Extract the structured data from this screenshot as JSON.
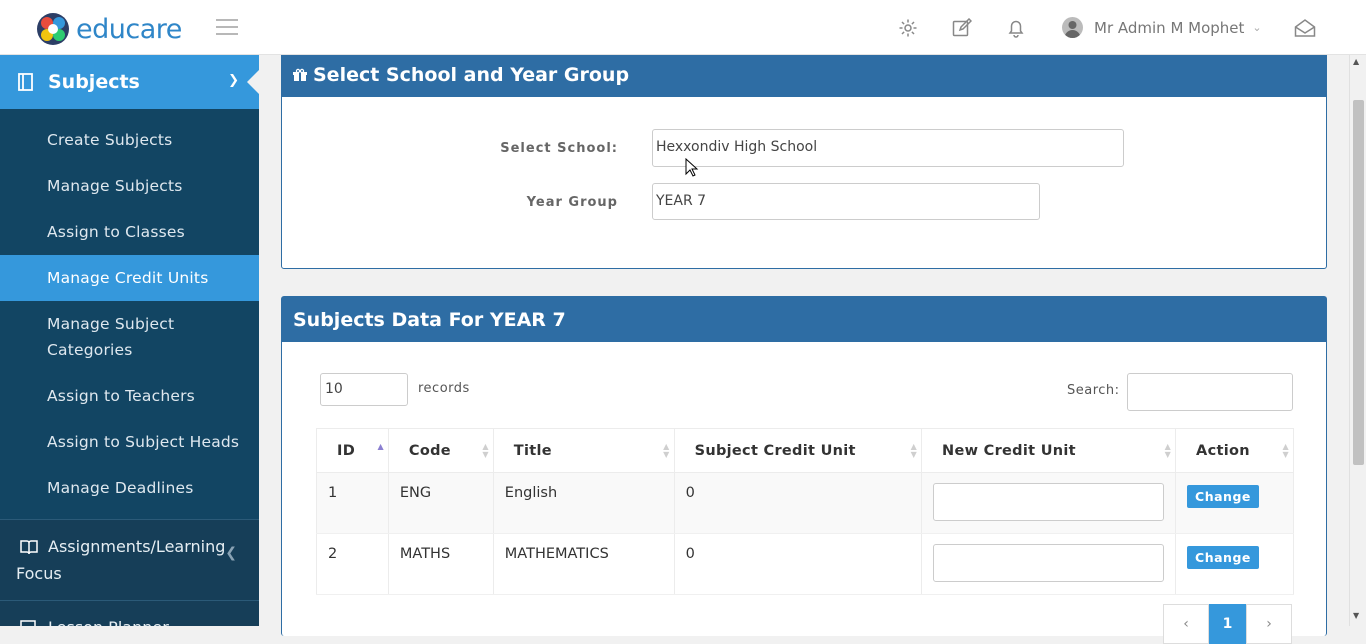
{
  "app": {
    "brand": "educare"
  },
  "topbar": {
    "user_name": "Mr Admin M Mophet"
  },
  "sidebar": {
    "section_title": "Subjects",
    "items": [
      {
        "label": "Create Subjects"
      },
      {
        "label": "Manage Subjects"
      },
      {
        "label": "Assign to Classes"
      },
      {
        "label": "Manage Credit Units"
      },
      {
        "label": "Manage Subject Categories"
      },
      {
        "label": "Assign to Teachers"
      },
      {
        "label": "Assign to Subject Heads"
      },
      {
        "label": "Manage Deadlines"
      }
    ],
    "sections": [
      {
        "label": "Assignments/Learning Focus"
      },
      {
        "label": "Lesson Planner"
      }
    ]
  },
  "select_panel": {
    "title": "Select School and Year Group",
    "school_label": "Select School:",
    "school_value": "Hexxondiv High School",
    "year_label": "Year Group",
    "year_value": "YEAR 7"
  },
  "data_panel": {
    "title": "Subjects Data For YEAR 7",
    "records_value": "10",
    "records_label": "records",
    "search_label": "Search:",
    "columns": [
      "ID",
      "Code",
      "Title",
      "Subject Credit Unit",
      "New Credit Unit",
      "Action"
    ],
    "rows": [
      {
        "id": "1",
        "code": "ENG",
        "title": "English",
        "credit": "0",
        "action": "Change"
      },
      {
        "id": "2",
        "code": "MATHS",
        "title": "MATHEMATICS",
        "credit": "0",
        "action": "Change"
      }
    ],
    "pager": {
      "prev": "‹",
      "current": "1",
      "next": "›"
    }
  }
}
